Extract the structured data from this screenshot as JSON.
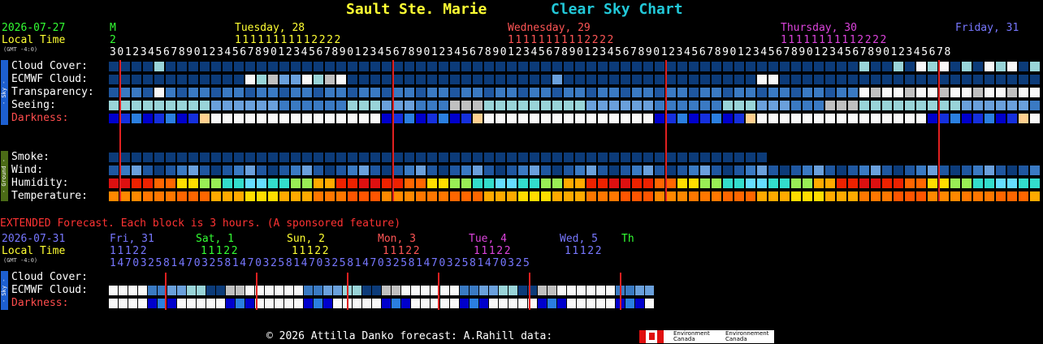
{
  "header": {
    "location": "Sault Ste. Marie",
    "chart_title": "Clear Sky Chart"
  },
  "main": {
    "date": "2026-07-27",
    "local_time": "Local Time",
    "gmt": "(GMT -4:0)",
    "day_labels": [
      {
        "text": "M",
        "color": "#33ff33"
      },
      {
        "text": "Tuesday, 28",
        "color": "#ffff33"
      },
      {
        "text": "Wednesday, 29",
        "color": "#ff5555"
      },
      {
        "text": "Thursday, 30",
        "color": "#dd44dd"
      },
      {
        "text": "Friday, 31",
        "color": "#7777ff"
      }
    ],
    "hour_first_digit": "2",
    "tens_tue": "11111111112222",
    "tens_wed": "11111111112222",
    "tens_thu": "11111111112222",
    "hours_row": "30123456789012345678901234567890123456789012345678901234567890123456789012345678901234567890123456789012345678",
    "labels": {
      "cloud": "Cloud Cover:",
      "ecmwf": "ECMWF Cloud:",
      "transparency": "Transparency:",
      "seeing": "Seeing:",
      "darkness": "Darkness:",
      "smoke": "Smoke:",
      "wind": "Wind:",
      "humidity": "Humidity:",
      "temperature": "Temperature:"
    },
    "side_sky": "- Sky -",
    "side_ground": "- Ground -"
  },
  "extended": {
    "notice": "EXTENDED Forecast. Each block is 3 hours. (A sponsored feature)",
    "date": "2026-07-31",
    "local_time": "Local Time",
    "gmt": "(GMT -4:0)",
    "day_labels": [
      {
        "text": "Fri, 31",
        "color": "#7777ff"
      },
      {
        "text": "Sat, 1",
        "color": "#33ff33"
      },
      {
        "text": "Sun, 2",
        "color": "#ffff33"
      },
      {
        "text": "Mon, 3",
        "color": "#ff5555"
      },
      {
        "text": "Tue, 4",
        "color": "#dd44dd"
      },
      {
        "text": "Wed, 5",
        "color": "#7777ff"
      },
      {
        "text": "Th",
        "color": "#33ff33"
      }
    ],
    "tens_groups": [
      "11122",
      "11122",
      "11122",
      "11122",
      "11122",
      "11122"
    ],
    "hours_row": "1470325814703258147032581470325814703258147032581470325",
    "labels": {
      "cloud": "Cloud Cover:",
      "ecmwf": "ECMWF Cloud:",
      "darkness": "Darkness:"
    },
    "side_sky": "- Sky -"
  },
  "footer": {
    "copyright": "© 2026 Attilla Danko  forecast: A.Rahill  data:",
    "env_en": "Environment Canada",
    "env_fr": "Environnement Canada"
  },
  "colors": {
    "cloud_clear": "#0c3b79",
    "blue2": "#1f57a0",
    "blue3": "#3a7ac3",
    "blue4": "#6aa0dc",
    "cyan": "#99d4d8",
    "white": "#f8f8f8",
    "grey": "#c0c0c0",
    "dark_blue": "#0000cc",
    "red": "#dd1010",
    "orange": "#ff7700",
    "yellow": "#ffee00"
  }
}
